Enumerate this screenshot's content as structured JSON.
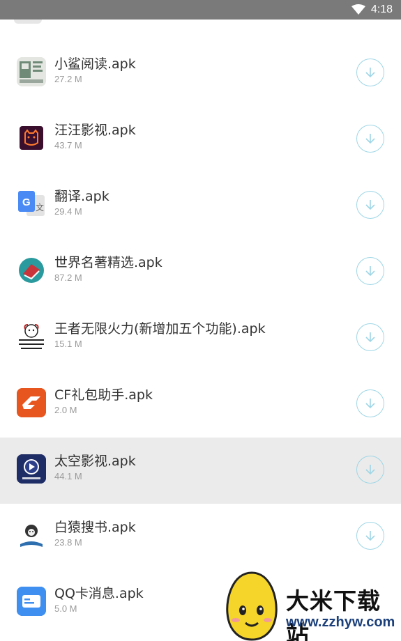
{
  "status_bar": {
    "time": "4:18",
    "wifi_icon": "wifi-icon"
  },
  "apps": [
    {
      "name": "小鲨阅读.apk",
      "size": "27.2 M",
      "icon": "xiaosha-reader-icon"
    },
    {
      "name": "汪汪影视.apk",
      "size": "43.7 M",
      "icon": "wangwang-video-icon"
    },
    {
      "name": "翻译.apk",
      "size": "29.4 M",
      "icon": "google-translate-icon"
    },
    {
      "name": "世界名著精选.apk",
      "size": "87.2 M",
      "icon": "classic-books-icon"
    },
    {
      "name": "王者无限火力(新增加五个功能).apk",
      "size": "15.1 M",
      "icon": "meme-icon"
    },
    {
      "name": "CF礼包助手.apk",
      "size": "2.0 M",
      "icon": "cf-gift-icon"
    },
    {
      "name": "太空影视.apk",
      "size": "44.1 M",
      "icon": "space-video-icon",
      "highlighted": true
    },
    {
      "name": "白猿搜书.apk",
      "size": "23.8 M",
      "icon": "ape-book-search-icon"
    },
    {
      "name": "QQ卡消息.apk",
      "size": "5.0 M",
      "icon": "qq-card-icon"
    }
  ],
  "watermark": {
    "title": "大米下载站",
    "url": "www.zzhyw.com"
  },
  "colors": {
    "download_ring": "#9fd6e6",
    "highlight_row": "#ebebeb",
    "status_bar": "#7a7a7a"
  }
}
